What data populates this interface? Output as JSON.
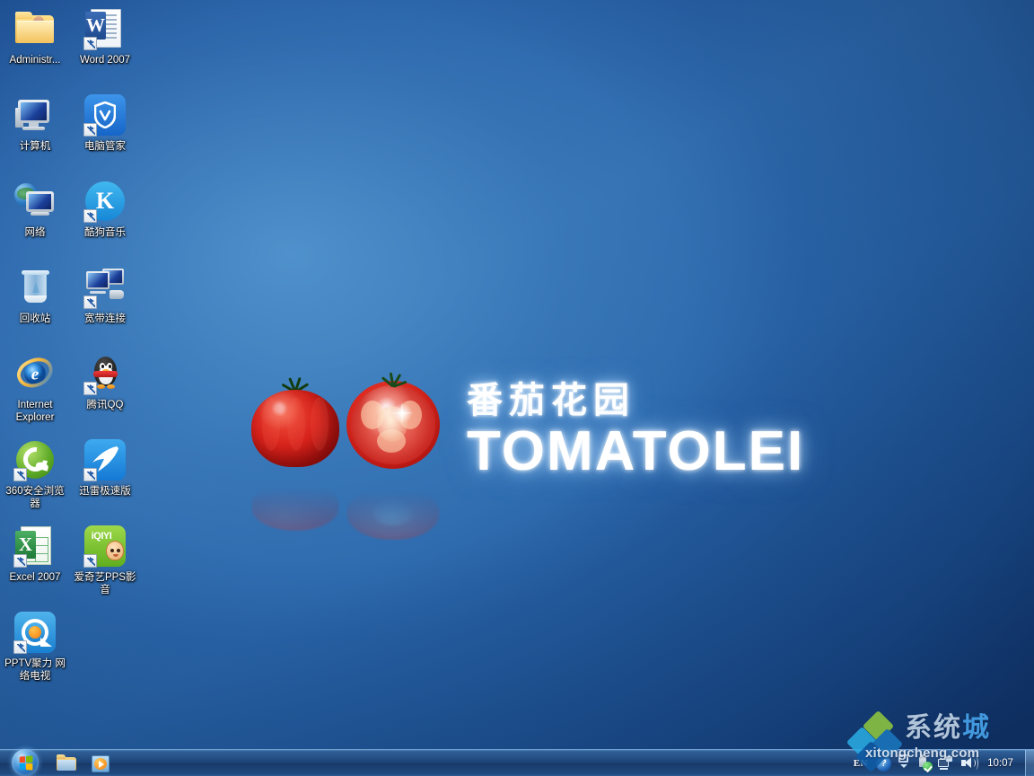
{
  "desktop": {
    "background_colors": {
      "top_left": "#2c6aad",
      "top_right": "#134182",
      "center_glow": "#5ca0d7",
      "bottom": "#153f7e"
    },
    "icons": [
      {
        "label": "Administr...",
        "art": "userfolder",
        "shortcut": false
      },
      {
        "label": "Word 2007",
        "art": "word",
        "shortcut": true
      },
      {
        "label": "计算机",
        "art": "computer",
        "shortcut": false
      },
      {
        "label": "电脑管家",
        "art": "guard",
        "shortcut": true
      },
      {
        "label": "网络",
        "art": "network",
        "shortcut": false
      },
      {
        "label": "酷狗音乐",
        "art": "kugou",
        "shortcut": true
      },
      {
        "label": "回收站",
        "art": "bin",
        "shortcut": false
      },
      {
        "label": "宽带连接",
        "art": "bb",
        "shortcut": true
      },
      {
        "label": "Internet Explorer",
        "art": "ie",
        "shortcut": false
      },
      {
        "label": "腾讯QQ",
        "art": "qq",
        "shortcut": true
      },
      {
        "label": "360安全浏览器",
        "art": "b360",
        "shortcut": true
      },
      {
        "label": "迅雷极速版",
        "art": "xunlei",
        "shortcut": true
      },
      {
        "label": "Excel 2007",
        "art": "excel",
        "shortcut": true
      },
      {
        "label": "爱奇艺PPS影音",
        "art": "pps",
        "shortcut": true
      },
      {
        "label": "PPTV聚力 网络电视",
        "art": "pptv",
        "shortcut": true
      }
    ]
  },
  "logo": {
    "chinese": "番茄花园",
    "english": "TOMATOLEI",
    "tomato_color": "#d8231c",
    "glow_color": "#ffffff"
  },
  "taskbar": {
    "start_button": "start-orb",
    "start_flag_colors": [
      "#f25022",
      "#7fba00",
      "#00a4ef",
      "#ffb900"
    ],
    "quicklaunch": [
      {
        "name": "windows-explorer",
        "label": "Windows 资源管理器"
      },
      {
        "name": "windows-media-player",
        "label": "Windows Media Player"
      }
    ],
    "tray": {
      "language": "EN",
      "help": "?",
      "show_hidden": "chevron-up",
      "usb_status": "safe-to-remove",
      "network": "network-connected",
      "volume": "volume-on",
      "clock_time": "10:07"
    }
  },
  "watermark": {
    "chinese_part1": "系统",
    "chinese_part2": "城",
    "url": "xitongcheng.com",
    "diamond_colors": [
      "#8dc63f",
      "#29abe2",
      "#1b75bc",
      "#0e5ba6"
    ],
    "accent_color": "#4aa8f0"
  }
}
